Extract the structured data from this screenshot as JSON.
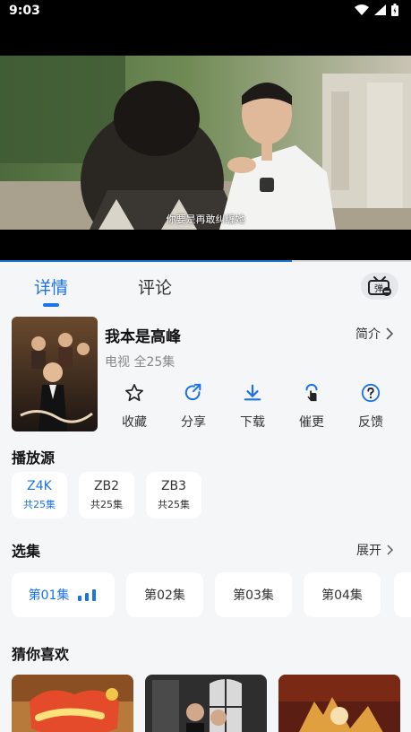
{
  "status": {
    "time": "9:03"
  },
  "player": {
    "subtitle": "你要是再敢纠缠她",
    "progress": 0.71
  },
  "tabs": {
    "details": "详情",
    "comments": "评论",
    "danmaku_glyph": "弹"
  },
  "show": {
    "title": "我本是高峰",
    "meta": "电视 全25集",
    "intro_label": "简介"
  },
  "actions": [
    {
      "label": "收藏",
      "icon": "star-icon"
    },
    {
      "label": "分享",
      "icon": "share-icon"
    },
    {
      "label": "下载",
      "icon": "download-icon"
    },
    {
      "label": "催更",
      "icon": "tap-icon"
    },
    {
      "label": "反馈",
      "icon": "help-icon"
    }
  ],
  "sources": {
    "title": "播放源",
    "items": [
      {
        "name": "Z4K",
        "count": "共25集"
      },
      {
        "name": "ZB2",
        "count": "共25集"
      },
      {
        "name": "ZB3",
        "count": "共25集"
      }
    ]
  },
  "episodes": {
    "title": "选集",
    "expand_label": "展开",
    "items": [
      "第01集",
      "第02集",
      "第03集",
      "第04集"
    ]
  },
  "recommend": {
    "title": "猜你喜欢"
  },
  "colors": {
    "accent": "#1a73e8",
    "background": "#f5f6f8"
  }
}
